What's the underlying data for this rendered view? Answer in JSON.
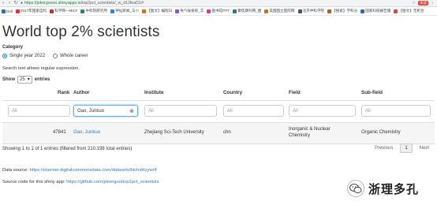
{
  "browser": {
    "url_host": "https://jokergoooo.shinyapps.io",
    "url_path": "/top2pct_scientists/_w_d12fea01/#",
    "profile_badge": "未读",
    "bookmarks": [
      {
        "label": "Dell",
        "color": "#2b6cb0"
      },
      {
        "label": "2017年国家自科",
        "color": "#d33"
      },
      {
        "label": "科学网—MiCF",
        "color": "#c53030"
      },
      {
        "label": "中科院研究所",
        "color": "#2f855a"
      },
      {
        "label": "神仙新闻_与小",
        "color": "#3182ce"
      },
      {
        "label": "【图文】编程日",
        "color": "#dd6b20"
      },
      {
        "label": "免气候投标_实",
        "color": "#805ad5"
      },
      {
        "label": "图书馆PPT",
        "color": "#d53f8c"
      },
      {
        "label": "聚焦期刊网_图",
        "color": "#2c7a7b"
      },
      {
        "label": "美国国立医院网",
        "color": "#b7791f"
      },
      {
        "label": "北京中科学院",
        "color": "#4a5568"
      },
      {
        "label": "【搜索】学科分",
        "color": "#c05621"
      },
      {
        "label": "国家科技报告服",
        "color": "#2b6cb0"
      },
      {
        "label": "【图文】无机合",
        "color": "#e53e3e"
      }
    ]
  },
  "page": {
    "title": "World top 2% scientists",
    "category_label": "Category",
    "options": [
      {
        "label": "Single year 2022",
        "checked": true
      },
      {
        "label": "Whole career",
        "checked": false
      }
    ],
    "hint": "Search text allows regular expression.",
    "show_label": "Show",
    "show_value": "25",
    "entries_label": "entries"
  },
  "table": {
    "headers": [
      "Rank",
      "Author",
      "Institute",
      "Country",
      "Field",
      "Sub-field"
    ],
    "filters": [
      "All",
      "Gao, Junkuo",
      "All",
      "All",
      "All",
      "All"
    ],
    "rows": [
      {
        "rank": "47841",
        "author": "Gao, Junkuo",
        "institute": "Zhejiang Sci-Tech University",
        "country": "chn",
        "field_line1": "Inorganic & Nuclear",
        "field_line2": "Chemistry",
        "subfield": "Organic Chemistry"
      }
    ]
  },
  "pagination": {
    "info": "Showing 1 to 1 of 1 entries (filtered from 210,198 total entries)",
    "previous": "Previous",
    "page": "1",
    "next": "Next"
  },
  "footer": {
    "source_label": "Data source: ",
    "source_link": "https://elsevier.digitalcommonsdata.com/datasets/btchxktzyw/4",
    "code_label": "Source code for this shiny app: ",
    "code_link": "https://github.com/jokergoo/top2pct_scientists"
  },
  "watermark": {
    "text": "浙理多孔"
  }
}
